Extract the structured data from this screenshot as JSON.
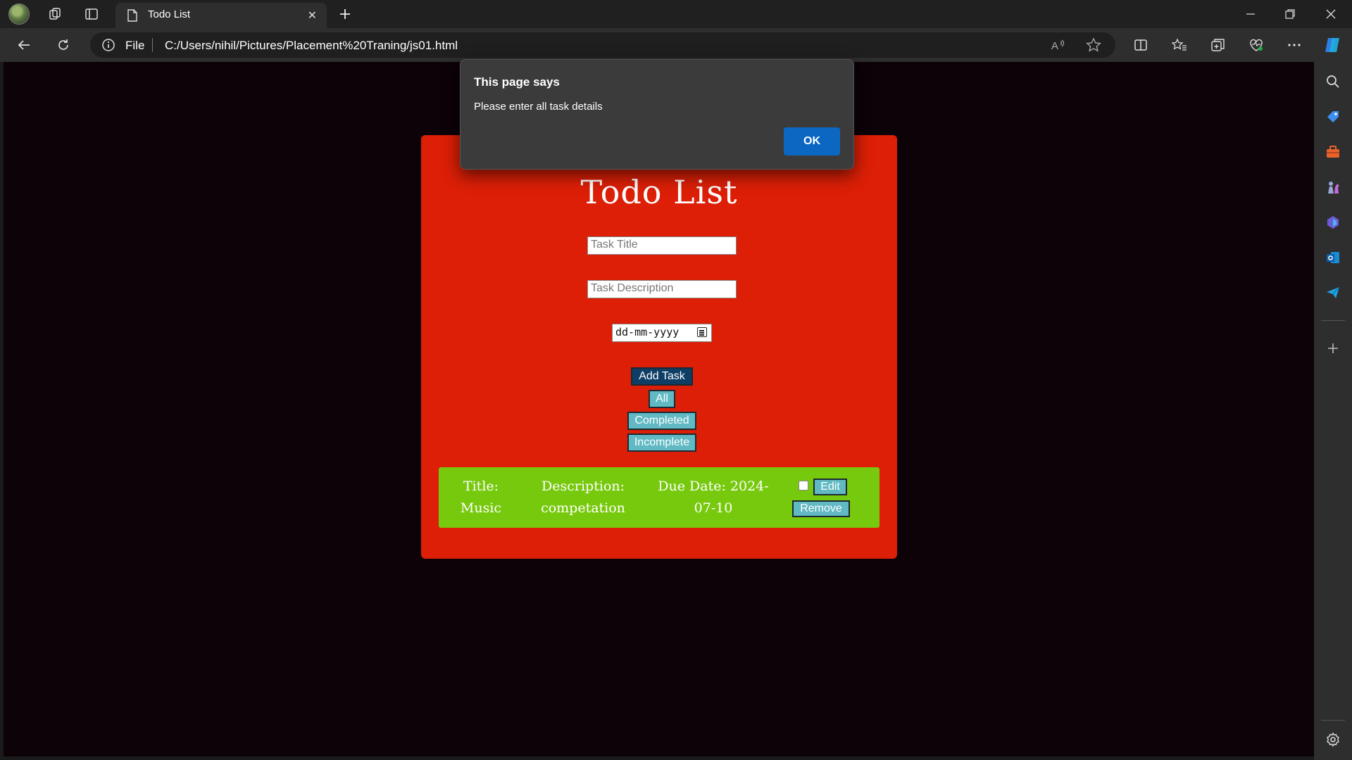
{
  "browser": {
    "tab_title": "Todo List",
    "address_scheme": "File",
    "address_url": "C:/Users/nihil/Pictures/Placement%20Traning/js01.html"
  },
  "app": {
    "title": "Todo List",
    "task_title_placeholder": "Task Title",
    "task_description_placeholder": "Task Description",
    "date_placeholder": "dd-mm-yyyy",
    "buttons": {
      "add": "Add Task",
      "all": "All",
      "completed": "Completed",
      "incomplete": "Incomplete"
    },
    "task": {
      "title": "Title: Music",
      "description": "Description: competation",
      "due_date": "Due Date: 2024-07-10",
      "completed": false,
      "edit_label": "Edit",
      "remove_label": "Remove"
    },
    "colors": {
      "card": "#dc1f06",
      "task_bg": "#77c90d",
      "button": "#60b9c3",
      "add_button": "#0e3d66",
      "page_bg": "#0c0208"
    }
  },
  "dialog": {
    "title": "This page says",
    "message": "Please enter all task details",
    "ok_label": "OK"
  },
  "icons": {
    "sidebar": [
      "search-icon",
      "tag-icon",
      "toolbox-icon",
      "chess-icon",
      "copilot-icon",
      "outlook-icon",
      "send-icon",
      "add-icon",
      "settings-icon"
    ]
  }
}
